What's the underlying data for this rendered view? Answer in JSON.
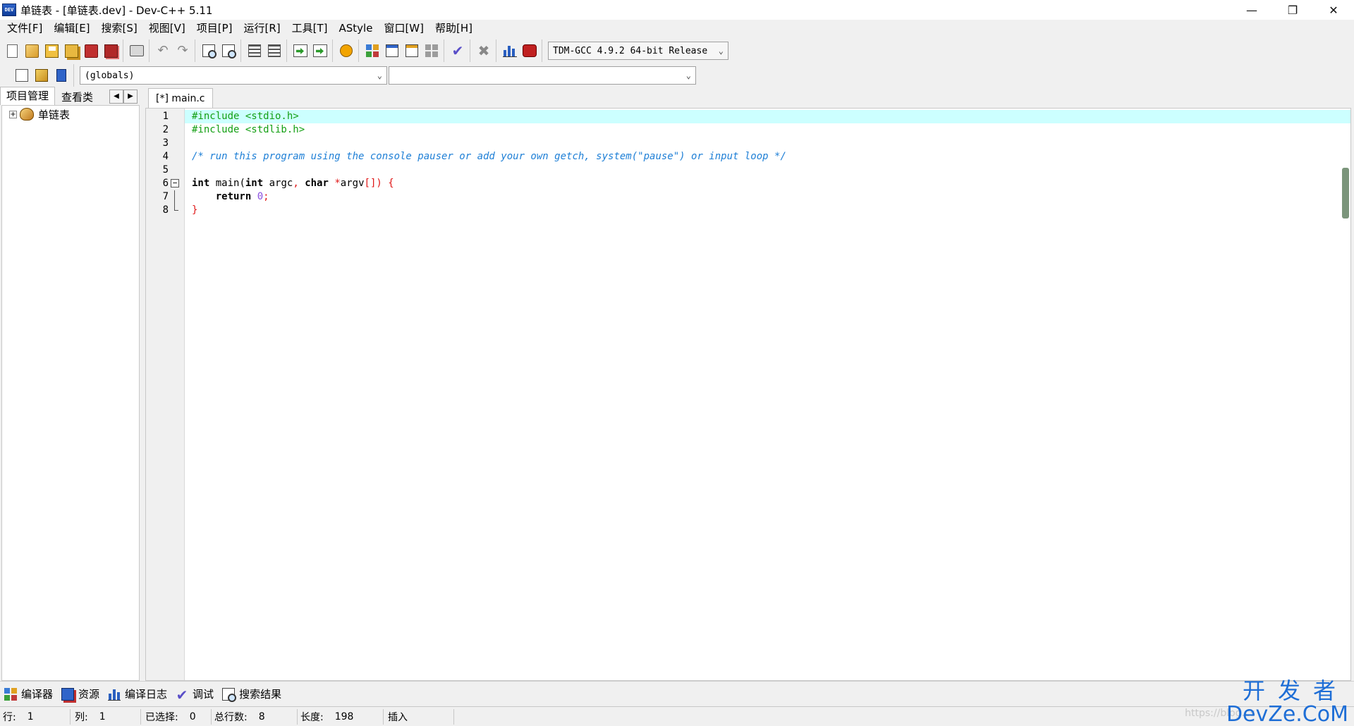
{
  "window": {
    "title": "单链表 - [单链表.dev] - Dev-C++ 5.11",
    "icon_text": "DEV"
  },
  "menu": [
    "文件[F]",
    "编辑[E]",
    "搜索[S]",
    "视图[V]",
    "项目[P]",
    "运行[R]",
    "工具[T]",
    "AStyle",
    "窗口[W]",
    "帮助[H]"
  ],
  "toolbar": {
    "compiler": "TDM-GCC 4.9.2 64-bit Release",
    "scope": "(globals)",
    "symbol": ""
  },
  "left_panel": {
    "tabs": [
      "项目管理",
      "查看类"
    ],
    "tree_root": "单链表"
  },
  "editor": {
    "tab_label": "[*] main.c",
    "line_numbers": [
      "1",
      "2",
      "3",
      "4",
      "5",
      "6",
      "7",
      "8"
    ],
    "lines": {
      "l1": "#include <stdio.h>",
      "l2": "#include <stdlib.h>",
      "l4": "/* run this program using the console pauser or add your own getch, system(\"pause\") or input loop */",
      "l6_kw1": "int",
      "l6_t1": " main(",
      "l6_kw2": "int",
      "l6_t2": " argc",
      "l6_s1": ",",
      "l6_t3": " ",
      "l6_kw3": "char",
      "l6_t4": " ",
      "l6_s2": "*",
      "l6_t5": "argv",
      "l6_s3": "[]) {",
      "l7_t1": "    ",
      "l7_kw": "return",
      "l7_t2": " ",
      "l7_num": "0",
      "l7_s": ";",
      "l8_s": "}"
    }
  },
  "bottom_tabs": [
    "编译器",
    "资源",
    "编译日志",
    "调试",
    "搜索结果"
  ],
  "status": {
    "row_label": "行:",
    "row": "1",
    "col_label": "列:",
    "col": "1",
    "sel_label": "已选择:",
    "sel": "0",
    "total_label": "总行数:",
    "total": "8",
    "len_label": "长度:",
    "len": "198",
    "mode": "插入"
  },
  "watermark": {
    "line1": "开发者",
    "line2": "DevZe.CoM",
    "faint": "https://blog.cs"
  }
}
